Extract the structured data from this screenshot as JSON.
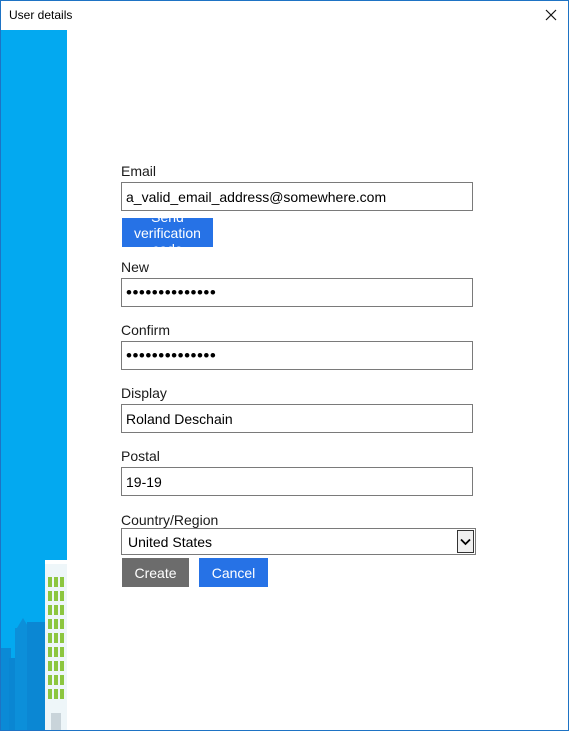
{
  "window": {
    "title": "User details"
  },
  "form": {
    "email": {
      "label": "Email Address",
      "value": "a_valid_email_address@somewhere.com"
    },
    "send_code_label": "Send verification code",
    "new_password": {
      "label": "New Password",
      "value": "••••••••••••••"
    },
    "confirm_password": {
      "label": "Confirm New Password",
      "value": "••••••••••••••"
    },
    "display_name": {
      "label": "Display Name",
      "value": "Roland Deschain"
    },
    "postal_code": {
      "label": "Postal Code",
      "value": "19-19"
    },
    "country": {
      "label": "Country/Region",
      "value": "United States"
    },
    "create_label": "Create",
    "cancel_label": "Cancel"
  },
  "colors": {
    "accent": "#2672e6",
    "side_panel": "#03a9f0",
    "create_button": "#6c6c6c",
    "window_border": "#1e73c4"
  },
  "icons": {
    "close": "close-icon",
    "dropdown": "chevron-down-icon"
  }
}
